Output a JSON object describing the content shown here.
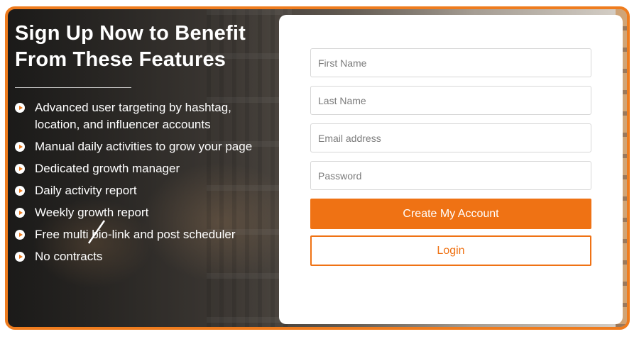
{
  "signup_promo": {
    "headline": "Sign Up Now to Benefit From These Features",
    "features": [
      {
        "text": "Advanced user targeting by hashtag, location, and influencer accounts",
        "icon": "chevron-right-icon"
      },
      {
        "text": "Manual daily activities to grow your page",
        "icon": "chevron-right-icon"
      },
      {
        "text": "Dedicated growth manager",
        "icon": "chevron-right-icon"
      },
      {
        "text": "Daily activity report",
        "icon": "chevron-right-icon"
      },
      {
        "text": "Weekly growth report",
        "icon": "chevron-right-icon"
      },
      {
        "text": "Free multi bio-link and post scheduler",
        "icon": "chevron-right-icon"
      },
      {
        "text": "No contracts",
        "icon": "chevron-right-icon"
      }
    ]
  },
  "form": {
    "first_name": {
      "placeholder": "First Name",
      "value": ""
    },
    "last_name": {
      "placeholder": "Last Name",
      "value": ""
    },
    "email": {
      "placeholder": "Email address",
      "value": ""
    },
    "password": {
      "placeholder": "Password",
      "value": ""
    },
    "create_account_label": "Create My Account",
    "login_label": "Login"
  },
  "colors": {
    "accent": "#ef7214",
    "frame_border": "#ef7c1e",
    "panel_background": "#ffffff",
    "text_on_image": "#ffffff"
  }
}
